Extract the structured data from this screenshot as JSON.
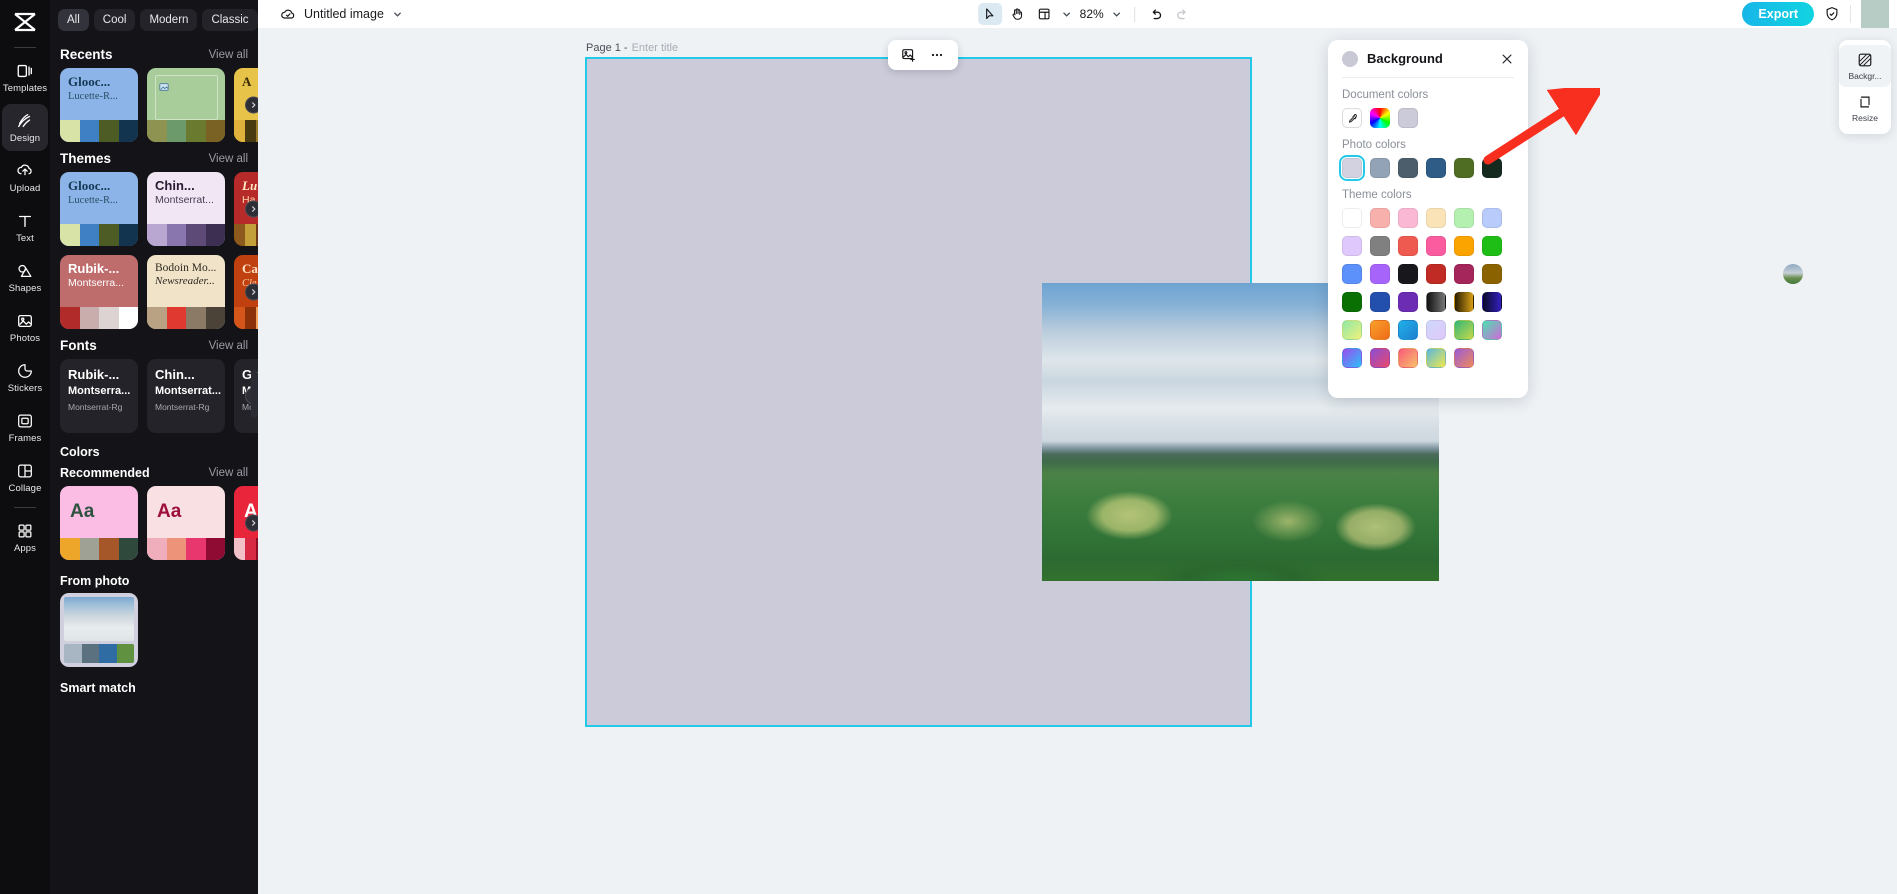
{
  "app": {
    "name": "CapCut Image Editor"
  },
  "rail": {
    "logo_icon": "capcut-logo-icon",
    "items": [
      {
        "label": "Templates",
        "icon": "templates-icon",
        "active": false
      },
      {
        "label": "Design",
        "icon": "design-icon",
        "active": true
      },
      {
        "label": "Upload",
        "icon": "upload-icon",
        "active": false
      },
      {
        "label": "Text",
        "icon": "text-icon",
        "active": false
      },
      {
        "label": "Shapes",
        "icon": "shapes-icon",
        "active": false
      },
      {
        "label": "Photos",
        "icon": "photos-icon",
        "active": false
      },
      {
        "label": "Stickers",
        "icon": "stickers-icon",
        "active": false
      },
      {
        "label": "Frames",
        "icon": "frames-icon",
        "active": false
      },
      {
        "label": "Collage",
        "icon": "collage-icon",
        "active": false
      },
      {
        "label": "Apps",
        "icon": "apps-icon",
        "active": false
      }
    ]
  },
  "panel": {
    "chips": [
      {
        "label": "All",
        "active": true
      },
      {
        "label": "Cool",
        "active": false
      },
      {
        "label": "Modern",
        "active": false
      },
      {
        "label": "Classic",
        "active": false
      }
    ],
    "chip_caret_icon": "chevron-down-icon",
    "view_all_label": "View all",
    "sections": {
      "recents": {
        "title": "Recents",
        "cards": [
          {
            "t1": "Glooc...",
            "t2": "Lucette-R...",
            "bg": "#8cb4e8",
            "t1c": "#163a56",
            "t2c": "#2b4f68",
            "strip": [
              "#d8e3a8",
              "#3f7fc4",
              "#4c5c24",
              "#12344f"
            ]
          },
          {
            "t1": "",
            "t2": "",
            "bg": "#a8cc9a",
            "t1c": "#2f4a22",
            "t2c": "#2f4a22",
            "thumb": true,
            "strip": [
              "#8f9352",
              "#6d9a6a",
              "#6a7a2e",
              "#7a6224"
            ]
          },
          {
            "t1": "A",
            "t2": "",
            "bg": "#e8c34a",
            "t1c": "#3a2a06",
            "t2c": "#3a2a06",
            "strip": [
              "#e0b23c",
              "#4a3a10",
              "#9a7a28",
              "#2b2208"
            ]
          }
        ]
      },
      "themes": {
        "title": "Themes",
        "cards": [
          {
            "t1": "Glooc...",
            "t2": "Lucette-R...",
            "bg": "#8cb4e8",
            "t1c": "#163a56",
            "t2c": "#2b4f68",
            "strip": [
              "#d8e3a8",
              "#3f7fc4",
              "#4c5c24",
              "#12344f"
            ]
          },
          {
            "t1": "Chin...",
            "t2": "Montserrat...",
            "bg": "#f0e6f4",
            "t1c": "#2b1a33",
            "t2c": "#4a3a52",
            "strip": [
              "#b9a7d2",
              "#8a76ae",
              "#5e4a77",
              "#3d2f52"
            ]
          },
          {
            "t1": "Lu",
            "t2": "Ha",
            "bg": "#b72a2a",
            "t1c": "#ffe9c2",
            "t2c": "#ffd9a8",
            "strip": [
              "#8d5a1e",
              "#c4a03a",
              "#6b3a14",
              "#3a1c0a"
            ]
          },
          {
            "t1": "Rubik-...",
            "t2": "Montserra...",
            "bg": "#bf6c6c",
            "t1c": "#ffffff",
            "t2c": "#ffffff",
            "strip": [
              "#b22b2b",
              "#c9acac",
              "#ddd3d3",
              "#ffffff"
            ]
          },
          {
            "t1": "Bodoin Mo...",
            "t2": "Newsreader...",
            "bg": "#f0e3c8",
            "t1c": "#2e2a22",
            "t2c": "#2e2a22",
            "strip": [
              "#b9a184",
              "#e03a30",
              "#8b7a66",
              "#4b4338"
            ]
          },
          {
            "t1": "Ca",
            "t2": "Cle",
            "bg": "#c0410f",
            "t1c": "#ffe0c2",
            "t2c": "#ffd0a8",
            "strip": [
              "#d4561a",
              "#8d3208",
              "#f0a35a",
              "#3c1805"
            ]
          }
        ]
      },
      "fonts": {
        "title": "Fonts",
        "cards": [
          {
            "f1": "Rubik-...",
            "f2": "Montserra...",
            "f3": "Montserrat-Rg"
          },
          {
            "f1": "Chin...",
            "f2": "Montserrat...",
            "f3": "Montserrat-Rg"
          },
          {
            "f1": "Gu",
            "f2": "Mor",
            "f3": "Mo"
          }
        ]
      },
      "colors": {
        "title": "Colors",
        "recommended_label": "Recommended",
        "recommended": [
          {
            "aa": "Aa",
            "bg": "#fbbde4",
            "fg": "#2e5240",
            "strip": [
              "#eda52a",
              "#9ea193",
              "#a5572a",
              "#2f4a3c"
            ]
          },
          {
            "aa": "Aa",
            "bg": "#f8e0e3",
            "fg": "#9d0f3d",
            "strip": [
              "#f0aebc",
              "#ec9379",
              "#e8376f",
              "#8f0b34"
            ]
          },
          {
            "aa": "A",
            "bg": "#e8253a",
            "fg": "#ffffff",
            "strip": [
              "#f2c0c8",
              "#d92a44",
              "#8b0f22",
              "#4a0612"
            ]
          }
        ],
        "from_photo_label": "From photo",
        "from_photo_strip": [
          "#a8b6c3",
          "#5b7180",
          "#2f6ca3",
          "#5f9140"
        ],
        "smart_match_label": "Smart match"
      }
    }
  },
  "topbar": {
    "cloud_icon": "cloud-check-icon",
    "doc_title": "Untitled image",
    "doc_caret_icon": "chevron-down-icon",
    "tools": [
      {
        "name": "select-tool",
        "icon": "cursor-arrow-icon",
        "selected": true
      },
      {
        "name": "hand-tool",
        "icon": "hand-icon",
        "selected": false
      },
      {
        "name": "layout-tool",
        "icon": "layout-icon",
        "selected": false
      }
    ],
    "layout_caret_icon": "chevron-down-icon",
    "zoom_level": "82%",
    "zoom_caret_icon": "chevron-down-icon",
    "undo_icon": "undo-icon",
    "redo_icon": "redo-icon",
    "export_label": "Export",
    "shield_icon": "shield-check-icon"
  },
  "canvas": {
    "page_label": "Page 1 -",
    "page_title_placeholder": "Enter title",
    "floating_toolbar": [
      {
        "name": "replace-image-button",
        "icon": "image-plus-icon"
      },
      {
        "name": "more-options-button",
        "icon": "ellipsis-icon"
      }
    ],
    "page_bg_color": "#cbcbd9",
    "selection_color": "#22c9e8"
  },
  "background_panel": {
    "title": "Background",
    "close_icon": "close-icon",
    "document_colors_label": "Document colors",
    "document_colors": [
      {
        "name": "eyedropper",
        "type": "picker",
        "icon": "eyedropper-icon"
      },
      {
        "name": "color-wheel",
        "type": "wheel"
      },
      {
        "name": "current",
        "color": "#cbcbd9"
      }
    ],
    "photo_colors_label": "Photo colors",
    "photo_colors": [
      {
        "name": "photo-thumb",
        "type": "photo"
      },
      {
        "color": "#d2d2e0",
        "selected": true
      },
      {
        "color": "#93a3b7"
      },
      {
        "color": "#4c5d6b"
      },
      {
        "color": "#2f5c86"
      },
      {
        "color": "#4f6e24"
      },
      {
        "color": "#152a1f"
      }
    ],
    "theme_colors_label": "Theme colors",
    "theme_colors": [
      "#ffffff",
      "#f8b0ad",
      "#fbb8d4",
      "#fbe3b8",
      "#b4f0b0",
      "#b8cbfa",
      "#dfc8fb",
      "#808080",
      "#ef5a50",
      "#fb5ca0",
      "#fba400",
      "#1fbe16",
      "#5c90fb",
      "#a764fb",
      "#18181c",
      "#c02b26",
      "#a5265a",
      "#8a6300",
      "#0a7004",
      "#2450ad",
      "#6c2cb4",
      "linear-gradient(90deg,#111 0%,#777 100%)",
      "linear-gradient(90deg,#2a1e00 0%,#d8a016 100%)",
      "linear-gradient(90deg,#0a0a28 0%,#3320c0 100%)",
      "linear-gradient(135deg,#8fe8a8 0%,#f0f07a 100%)",
      "linear-gradient(135deg,#f7a02a 0%,#f06a18 100%)",
      "linear-gradient(135deg,#1fb0e8 0%,#1f7fd0 100%)",
      "linear-gradient(135deg,#cfd8fb 0%,#dfc8fb 100%)",
      "linear-gradient(135deg,#34b878 0%,#c8d84a 100%)",
      "linear-gradient(135deg,#4ce0b0 0%,#d06ad8 100%)",
      "linear-gradient(135deg,#9a4cf0 0%,#2ec0f8 100%)",
      "linear-gradient(135deg,#8a4cd8 0%,#e84a6a 100%)",
      "linear-gradient(135deg,#f85a7a 0%,#f8c06a 100%)",
      "linear-gradient(135deg,#5ab8e0 0%,#f0e84a 100%)",
      "linear-gradient(135deg,#9a5ad8 0%,#f08a5a 100%)"
    ]
  },
  "right_rail": {
    "items": [
      {
        "label": "Backgr...",
        "icon": "background-icon",
        "active": true
      },
      {
        "label": "Resize",
        "icon": "resize-icon",
        "active": false
      }
    ]
  }
}
